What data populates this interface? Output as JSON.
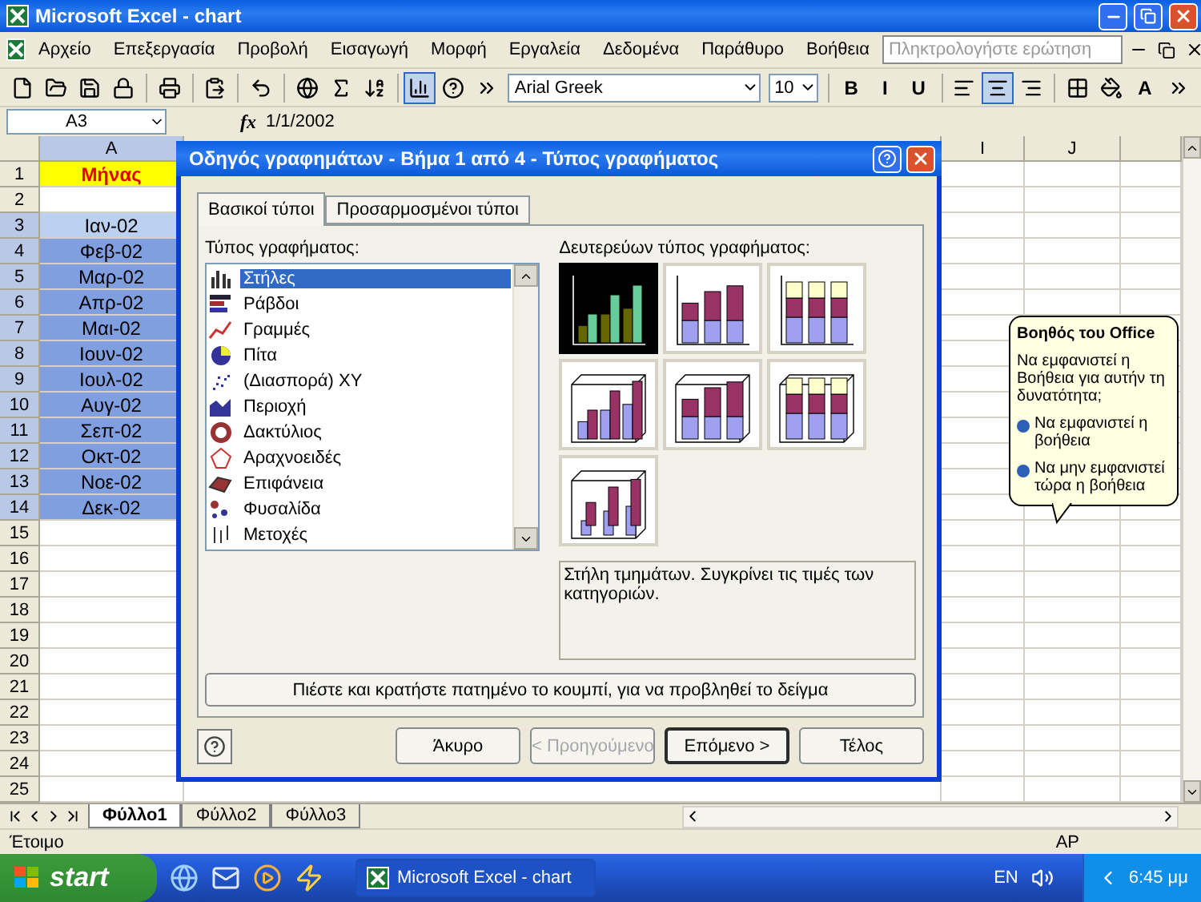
{
  "window": {
    "title": "Microsoft Excel - chart"
  },
  "menu": [
    "Αρχείο",
    "Επεξεργασία",
    "Προβολή",
    "Εισαγωγή",
    "Μορφή",
    "Εργαλεία",
    "Δεδομένα",
    "Παράθυρο",
    "Βοήθεια"
  ],
  "help_box": {
    "placeholder": "Πληκτρολογήστε ερώτηση"
  },
  "toolbar": [
    {
      "kind": "new",
      "pressed": false
    },
    {
      "kind": "open",
      "pressed": false
    },
    {
      "kind": "save",
      "pressed": false
    },
    {
      "kind": "permission",
      "pressed": false
    },
    {
      "kind": "sep"
    },
    {
      "kind": "print",
      "pressed": false
    },
    {
      "kind": "sep"
    },
    {
      "kind": "paste",
      "pressed": false
    },
    {
      "kind": "sep"
    },
    {
      "kind": "undo",
      "pressed": false
    },
    {
      "kind": "sep"
    },
    {
      "kind": "hyperlink",
      "pressed": false
    },
    {
      "kind": "autosum",
      "pressed": false
    },
    {
      "kind": "sort",
      "pressed": false
    },
    {
      "kind": "sep"
    },
    {
      "kind": "chart",
      "pressed": true
    },
    {
      "kind": "help",
      "pressed": false
    },
    {
      "kind": "more",
      "pressed": false
    },
    {
      "kind": "font",
      "value": "Arial Greek"
    },
    {
      "kind": "size",
      "value": "10"
    },
    {
      "kind": "sep"
    },
    {
      "kind": "text",
      "label": "B",
      "pressed": false
    },
    {
      "kind": "text",
      "label": "I",
      "pressed": false
    },
    {
      "kind": "text",
      "label": "U",
      "pressed": false
    },
    {
      "kind": "sep"
    },
    {
      "kind": "align-left",
      "pressed": false
    },
    {
      "kind": "align-center",
      "pressed": true
    },
    {
      "kind": "align-right",
      "pressed": false
    },
    {
      "kind": "sep"
    },
    {
      "kind": "borders",
      "pressed": false
    },
    {
      "kind": "fill",
      "pressed": false
    },
    {
      "kind": "text",
      "label": "A",
      "pressed": false
    },
    {
      "kind": "more",
      "pressed": false
    }
  ],
  "formula_bar": {
    "name_box": "A3",
    "function_label": "fx",
    "formula": "1/1/2002"
  },
  "columns": [
    {
      "label": "A",
      "selected": true
    },
    {
      "label": "I",
      "selected": false
    },
    {
      "label": "J",
      "selected": false
    }
  ],
  "rows": [
    {
      "label": "1",
      "value": "Μήνας",
      "kind": "heading",
      "selected": false,
      "active": false
    },
    {
      "label": "2",
      "kind": "plain",
      "selected": false,
      "active": false
    },
    {
      "label": "3",
      "value": "Ιαν-02",
      "kind": "plain",
      "selected": true,
      "active": true
    },
    {
      "label": "4",
      "value": "Φεβ-02",
      "kind": "plain",
      "selected": true,
      "active": false
    },
    {
      "label": "5",
      "value": "Μαρ-02",
      "kind": "plain",
      "selected": true,
      "active": false
    },
    {
      "label": "6",
      "value": "Απρ-02",
      "kind": "plain",
      "selected": true,
      "active": false
    },
    {
      "label": "7",
      "value": "Μαι-02",
      "kind": "plain",
      "selected": true,
      "active": false
    },
    {
      "label": "8",
      "value": "Ιουν-02",
      "kind": "plain",
      "selected": true,
      "active": false
    },
    {
      "label": "9",
      "value": "Ιουλ-02",
      "kind": "plain",
      "selected": true,
      "active": false
    },
    {
      "label": "10",
      "value": "Αυγ-02",
      "kind": "plain",
      "selected": true,
      "active": false
    },
    {
      "label": "11",
      "value": "Σεπ-02",
      "kind": "plain",
      "selected": true,
      "active": false
    },
    {
      "label": "12",
      "value": "Οκτ-02",
      "kind": "plain",
      "selected": true,
      "active": false
    },
    {
      "label": "13",
      "value": "Νοε-02",
      "kind": "plain",
      "selected": true,
      "active": false
    },
    {
      "label": "14",
      "value": "Δεκ-02",
      "kind": "plain",
      "selected": true,
      "active": false
    },
    {
      "label": "15",
      "kind": "plain",
      "selected": false,
      "active": false
    },
    {
      "label": "16",
      "kind": "plain",
      "selected": false,
      "active": false
    },
    {
      "label": "17",
      "kind": "plain",
      "selected": false,
      "active": false
    },
    {
      "label": "18",
      "kind": "plain",
      "selected": false,
      "active": false
    },
    {
      "label": "19",
      "kind": "plain",
      "selected": false,
      "active": false
    },
    {
      "label": "20",
      "kind": "plain",
      "selected": false,
      "active": false
    },
    {
      "label": "21",
      "kind": "plain",
      "selected": false,
      "active": false
    },
    {
      "label": "22",
      "kind": "plain",
      "selected": false,
      "active": false
    },
    {
      "label": "23",
      "kind": "plain",
      "selected": false,
      "active": false
    },
    {
      "label": "24",
      "kind": "plain",
      "selected": false,
      "active": false
    },
    {
      "label": "25",
      "kind": "plain",
      "selected": false,
      "active": false
    }
  ],
  "dialog": {
    "title": "Οδηγός γραφημάτων - Βήμα 1 από 4 - Τύπος γραφήματος",
    "tabs": [
      {
        "label": "Βασικοί τύποι",
        "selected": true
      },
      {
        "label": "Προσαρμοσμένοι τύποι",
        "selected": false
      }
    ],
    "type_label": "Τύπος γραφήματος:",
    "chart_types": [
      {
        "label": "Στήλες",
        "kind": "column",
        "selected": true
      },
      {
        "label": "Ράβδοι",
        "kind": "bar",
        "selected": false
      },
      {
        "label": "Γραμμές",
        "kind": "line",
        "selected": false
      },
      {
        "label": "Πίτα",
        "kind": "pie",
        "selected": false
      },
      {
        "label": "(Διασπορά) XY",
        "kind": "scatter",
        "selected": false
      },
      {
        "label": "Περιοχή",
        "kind": "area",
        "selected": false
      },
      {
        "label": "Δακτύλιος",
        "kind": "doughnut",
        "selected": false
      },
      {
        "label": "Αραχνοειδές",
        "kind": "radar",
        "selected": false
      },
      {
        "label": "Επιφάνεια",
        "kind": "surface",
        "selected": false
      },
      {
        "label": "Φυσαλίδα",
        "kind": "bubble",
        "selected": false
      },
      {
        "label": "Μετοχές",
        "kind": "stock",
        "selected": false
      }
    ],
    "subtype_label": "Δευτερεύων τύπος γραφήματος:",
    "subtypes": [
      {
        "kind": "clustered",
        "selected": true
      },
      {
        "kind": "stacked",
        "selected": false
      },
      {
        "kind": "stacked100",
        "selected": false
      },
      {
        "kind": "clustered-3d",
        "selected": false
      },
      {
        "kind": "stacked-3d",
        "selected": false
      },
      {
        "kind": "stacked100-3d",
        "selected": false
      },
      {
        "kind": "column-3d",
        "selected": false
      }
    ],
    "description": "Στήλη τμημάτων. Συγκρίνει τις τιμές των κατηγοριών.",
    "preview_button": "Πιέστε και κρατήστε πατημένο το κουμπί, για να προβληθεί το δείγμα",
    "buttons": [
      {
        "label": "Άκυρο",
        "disabled": false,
        "default": false
      },
      {
        "label": "< Προηγούμενο",
        "disabled": true,
        "default": false
      },
      {
        "label": "Επόμενο >",
        "disabled": false,
        "default": true
      },
      {
        "label": "Τέλος",
        "disabled": false,
        "default": false
      }
    ]
  },
  "assistant": {
    "title": "Βοηθός του Office",
    "question": "Να εμφανιστεί η Βοήθεια για αυτήν τη δυνατότητα;",
    "options": [
      "Να εμφανιστεί η βοήθεια",
      "Να μην εμφανιστεί τώρα η βοήθεια"
    ]
  },
  "sheet_tabs": [
    {
      "label": "Φύλλο1",
      "selected": true
    },
    {
      "label": "Φύλλο2",
      "selected": false
    },
    {
      "label": "Φύλλο3",
      "selected": false
    }
  ],
  "status": {
    "left": "Έτοιμο",
    "right": "ΑΡ"
  },
  "taskbar": {
    "start": "start",
    "tasks": [
      "Microsoft Excel - chart"
    ],
    "language": "EN",
    "clock": "6:45 μμ"
  }
}
